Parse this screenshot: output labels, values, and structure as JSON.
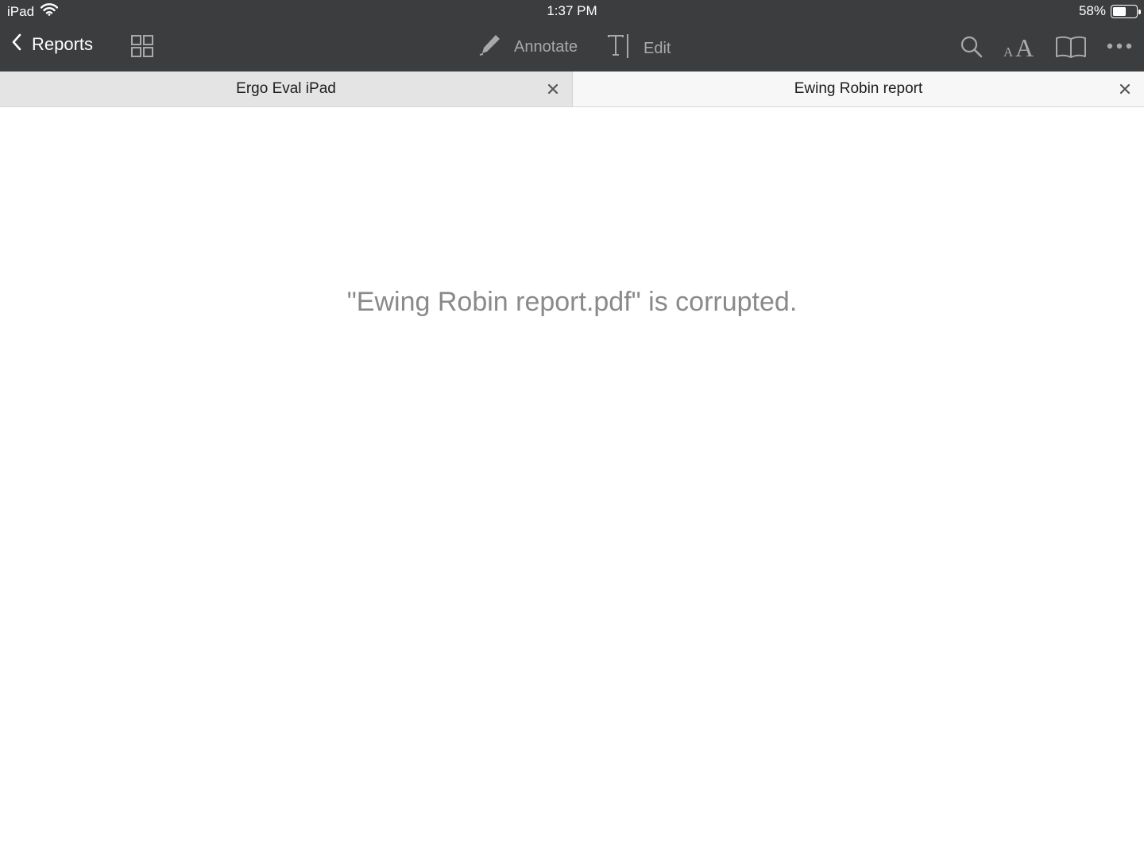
{
  "status_bar": {
    "device": "iPad",
    "time": "1:37 PM",
    "battery_percent": "58%",
    "battery_level": 0.58,
    "wifi_icon": "wifi-icon"
  },
  "toolbar": {
    "back_label": "Reports",
    "annotate_label": "Annotate",
    "edit_label": "Edit",
    "icons": [
      "chevron-left-icon",
      "grid-icon",
      "pencil-icon",
      "text-cursor-icon",
      "search-icon",
      "font-size-icon",
      "book-icon",
      "more-icon"
    ]
  },
  "tabs": [
    {
      "label": "Ergo Eval iPad",
      "active": false
    },
    {
      "label": "Ewing Robin report",
      "active": true
    }
  ],
  "document": {
    "message": "\"Ewing Robin report.pdf\" is corrupted."
  },
  "colors": {
    "toolbar_bg": "#3c3d3f",
    "disabled_text": "#a8a9ab",
    "message_text": "#8a8a8c"
  }
}
